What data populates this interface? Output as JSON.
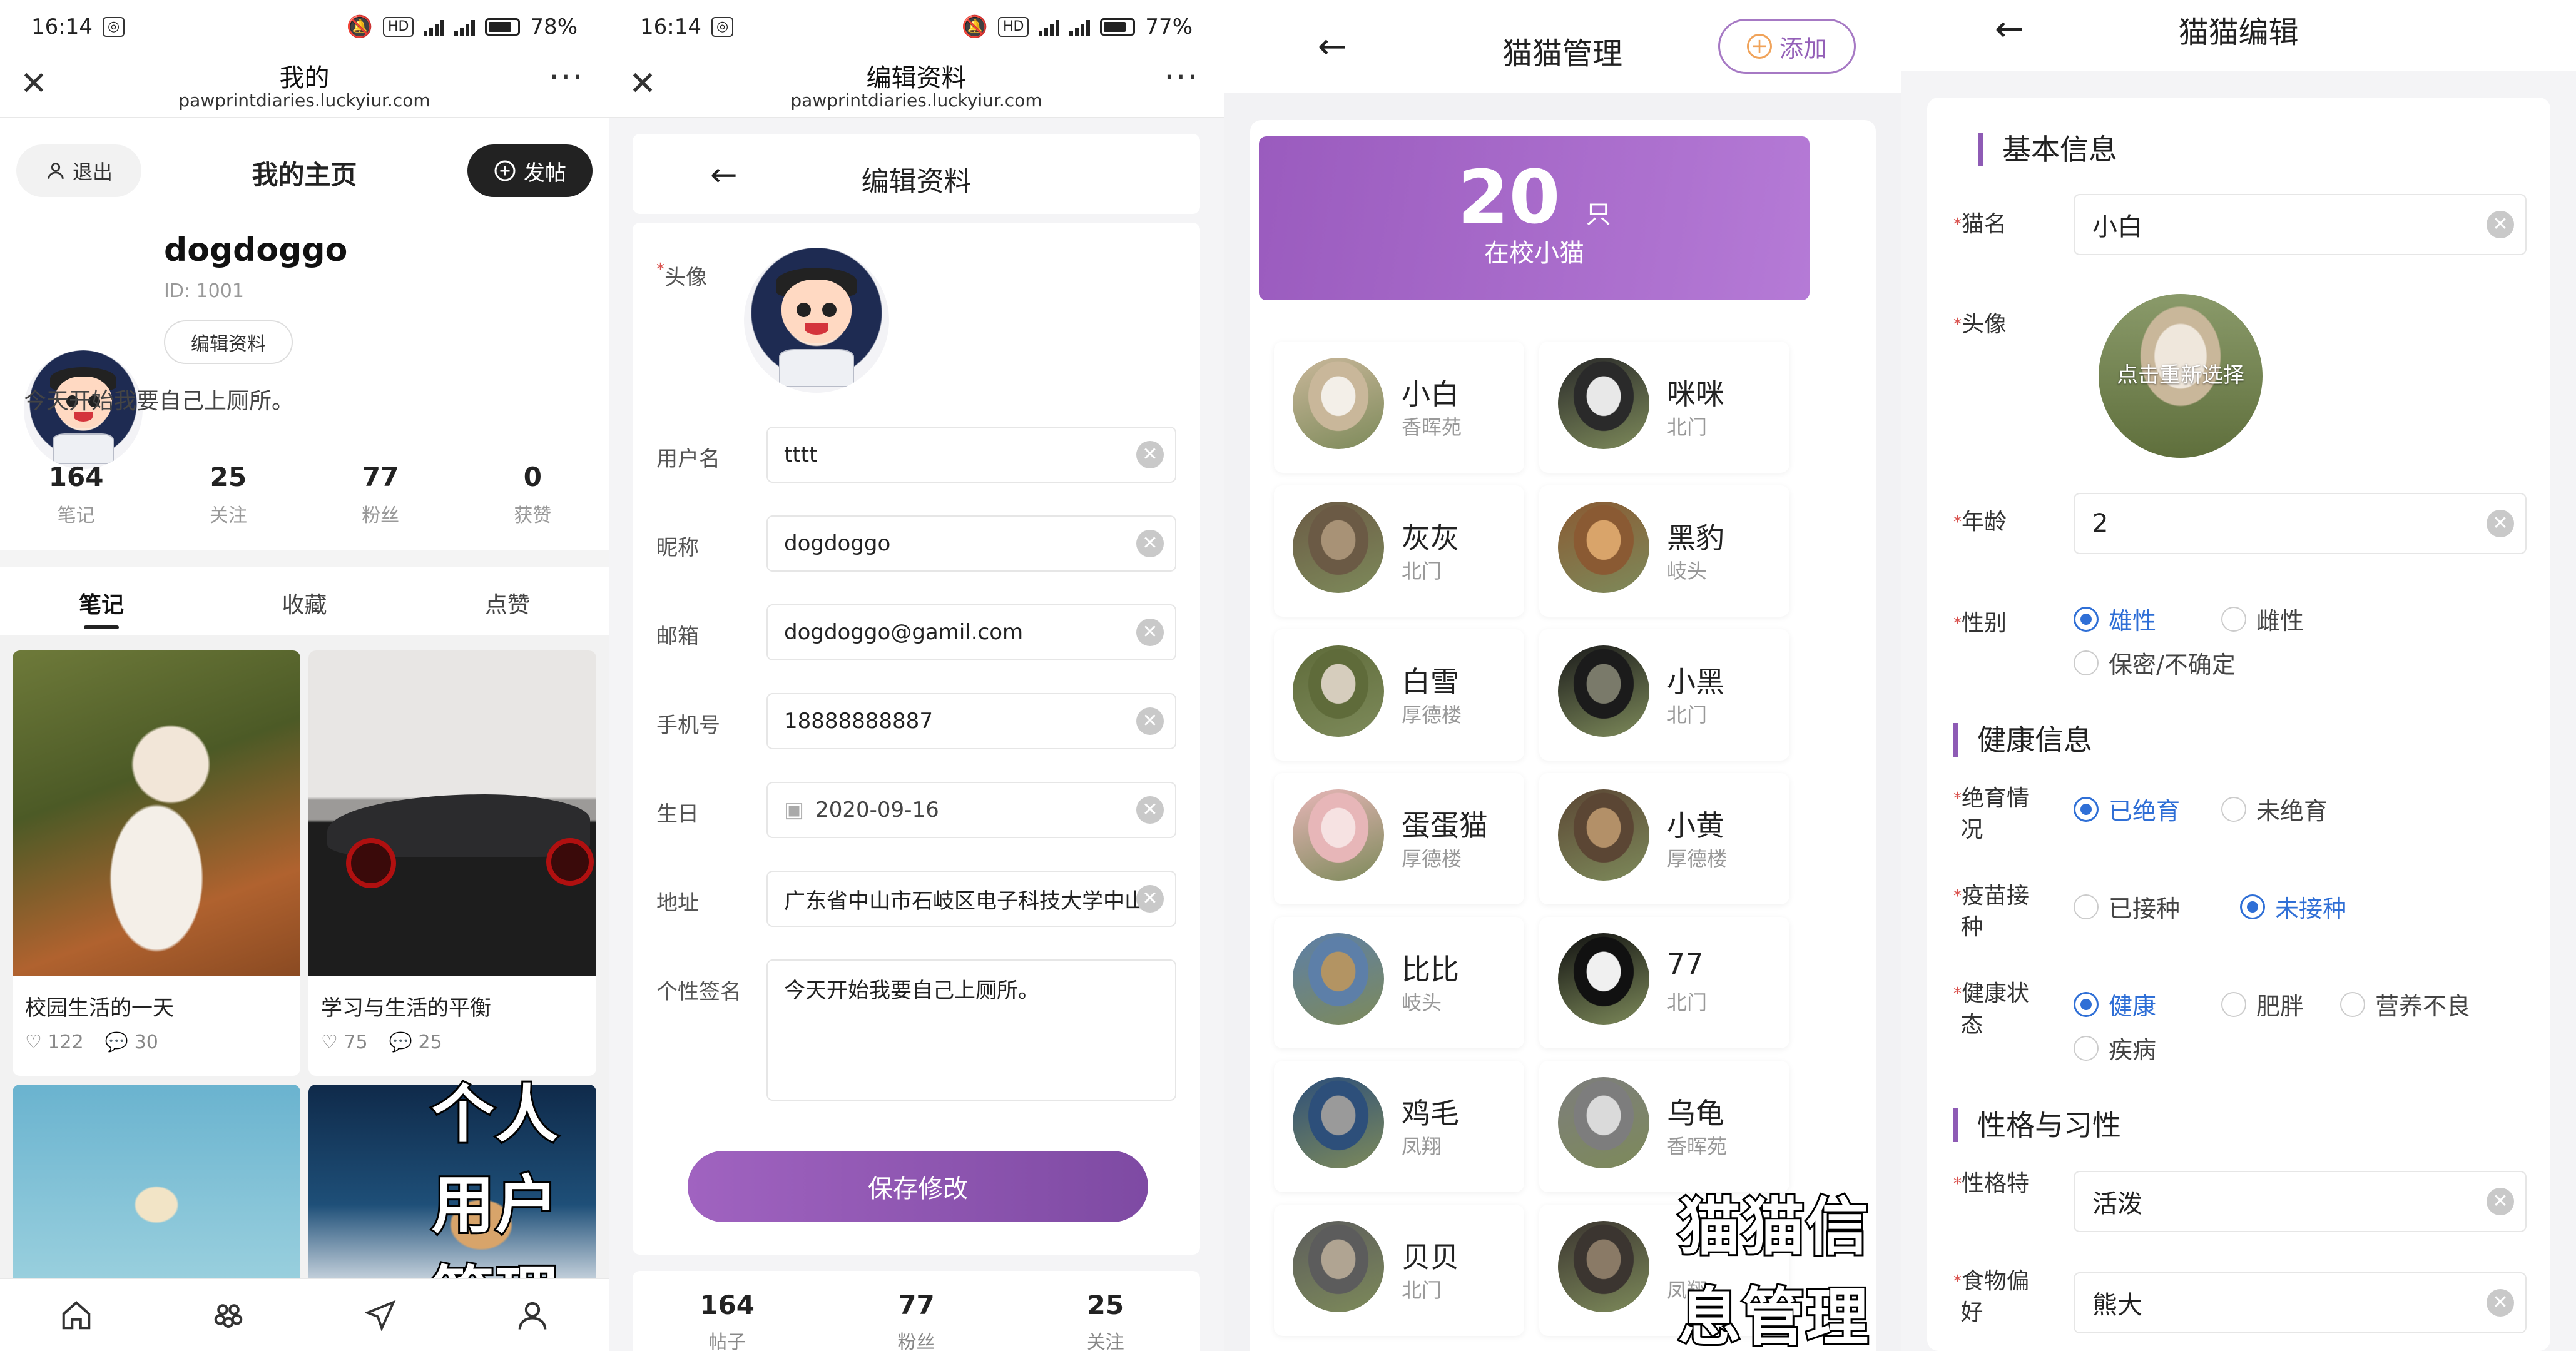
{
  "status": {
    "left": {
      "time": "16:14"
    },
    "mid": {
      "time": "16:14"
    },
    "battery_p1": "78",
    "battery_p2": "77",
    "pct": "%",
    "net": "4G",
    "net2": "5G",
    "hd": "HD"
  },
  "browser": {
    "p1_title": "我的",
    "p2_title": "编辑资料",
    "url": "pawprintdiaries.luckyiur.com",
    "more": "···"
  },
  "profile": {
    "logout": "退出",
    "page_title": "我的主页",
    "post": "发帖",
    "username": "dogdoggo",
    "id": "ID: 1001",
    "edit": "编辑资料",
    "bio": "今天开始我要自己上厕所。",
    "stats": [
      {
        "num": "164",
        "label": "笔记"
      },
      {
        "num": "25",
        "label": "关注"
      },
      {
        "num": "77",
        "label": "粉丝"
      },
      {
        "num": "0",
        "label": "获赞"
      }
    ],
    "tabs": [
      "笔记",
      "收藏",
      "点赞"
    ],
    "posts": [
      {
        "title": "校园生活的一天",
        "likes": "122",
        "comments": "30"
      },
      {
        "title": "学习与生活的平衡",
        "likes": "75",
        "comments": "25"
      }
    ],
    "caption": "个人用户管理"
  },
  "edit_profile": {
    "title": "编辑资料",
    "avatar_label": "头像",
    "fields": [
      {
        "label": "用户名",
        "value": "tttt"
      },
      {
        "label": "昵称",
        "value": "dogdoggo"
      },
      {
        "label": "邮箱",
        "value": "dogdoggo@gamil.com"
      },
      {
        "label": "手机号",
        "value": "18888888887"
      },
      {
        "label": "生日",
        "value": "2020-09-16"
      },
      {
        "label": "地址",
        "value": "广东省中山市石岐区电子科技大学中山"
      },
      {
        "label": "个性签名",
        "value": "今天开始我要自己上厕所。"
      }
    ],
    "save": "保存修改",
    "stats": [
      {
        "num": "164",
        "label": "帖子"
      },
      {
        "num": "77",
        "label": "粉丝"
      },
      {
        "num": "25",
        "label": "关注"
      }
    ]
  },
  "cat_manage": {
    "title": "猫猫管理",
    "add": "添加",
    "count": "20",
    "unit": "只",
    "count_label": "在校小猫",
    "cats": [
      {
        "name": "小白",
        "loc": "香晖苑",
        "c1": "#c9b79a",
        "c2": "#f3efe8"
      },
      {
        "name": "咪咪",
        "loc": "北门",
        "c1": "#2a2a2a",
        "c2": "#e8e8e8"
      },
      {
        "name": "灰灰",
        "loc": "北门",
        "c1": "#6b5a45",
        "c2": "#a89276"
      },
      {
        "name": "黑豹",
        "loc": "岐头",
        "c1": "#8a5a33",
        "c2": "#d9a46a"
      },
      {
        "name": "白雪",
        "loc": "厚德楼",
        "c1": "#5f6b3a",
        "c2": "#d6cdbd"
      },
      {
        "name": "小黑",
        "loc": "北门",
        "c1": "#1b1b1b",
        "c2": "#7a7a6a"
      },
      {
        "name": "蛋蛋猫",
        "loc": "厚德楼",
        "c1": "#e7b6b8",
        "c2": "#f6e2e2"
      },
      {
        "name": "小黄",
        "loc": "厚德楼",
        "c1": "#5b4634",
        "c2": "#b39068"
      },
      {
        "name": "比比",
        "loc": "岐头",
        "c1": "#5d7fa8",
        "c2": "#b39463"
      },
      {
        "name": "77",
        "loc": "北门",
        "c1": "#111111",
        "c2": "#f0f0f0"
      },
      {
        "name": "鸡毛",
        "loc": "凤翔",
        "c1": "#2d4f7a",
        "c2": "#9a9a9a"
      },
      {
        "name": "乌龟",
        "loc": "香晖苑",
        "c1": "#7d7d7d",
        "c2": "#dadada"
      },
      {
        "name": "贝贝",
        "loc": "北门",
        "c1": "#5c5c5c",
        "c2": "#b0a492"
      },
      {
        "name": "",
        "loc": "凤翔",
        "c1": "#3b3530",
        "c2": "#8a7a66"
      }
    ],
    "caption": "猫猫信息管理"
  },
  "cat_edit": {
    "title": "猫猫编辑",
    "sections": [
      "基本信息",
      "健康信息",
      "性格与习性"
    ],
    "name_label": "猫名",
    "name_value": "小白",
    "avatar_label": "头像",
    "avatar_overlay": "点击重新选择",
    "age_label": "年龄",
    "age_value": "2",
    "gender_label": "性别",
    "gender_options": [
      "雄性",
      "雌性",
      "保密/不确定"
    ],
    "sterile_label_1": "绝育情",
    "sterile_label_2": "况",
    "sterile_options": [
      "已绝育",
      "未绝育"
    ],
    "vaccine_label_1": "疫苗接",
    "vaccine_label_2": "种",
    "vaccine_options": [
      "已接种",
      "未接种"
    ],
    "health_label_1": "健康状",
    "health_label_2": "态",
    "health_options": [
      "健康",
      "肥胖",
      "营养不良",
      "疾病"
    ],
    "trait_label": "性格特",
    "trait_value": "活泼",
    "food_label_1": "食物偏",
    "food_label_2": "好",
    "food_value": "熊大"
  },
  "colors": {
    "accent": "#9a5bbe",
    "radio_on": "#2f6fd6",
    "required": "#d9534f"
  }
}
